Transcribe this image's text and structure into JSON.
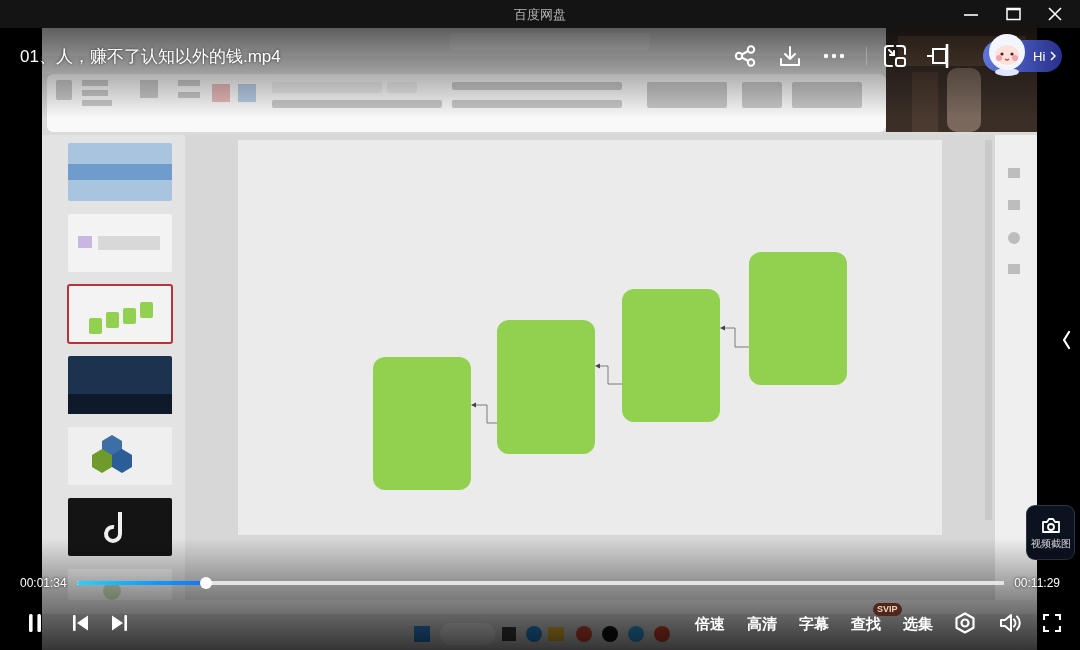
{
  "window": {
    "title": "百度网盘"
  },
  "player": {
    "video_title": "01、人，赚不了认知以外的钱.mp4",
    "assistant_label": "Hi",
    "screenshot_label": "视频截图",
    "playing": true
  },
  "progress": {
    "current_time": "00:01:34",
    "total_time": "00:11:29",
    "level": 0.139
  },
  "menu_buttons": [
    {
      "label": "倍速"
    },
    {
      "label": "高清"
    },
    {
      "label": "字幕"
    },
    {
      "label": "查找",
      "badge": "SVIP"
    },
    {
      "label": "选集"
    }
  ]
}
